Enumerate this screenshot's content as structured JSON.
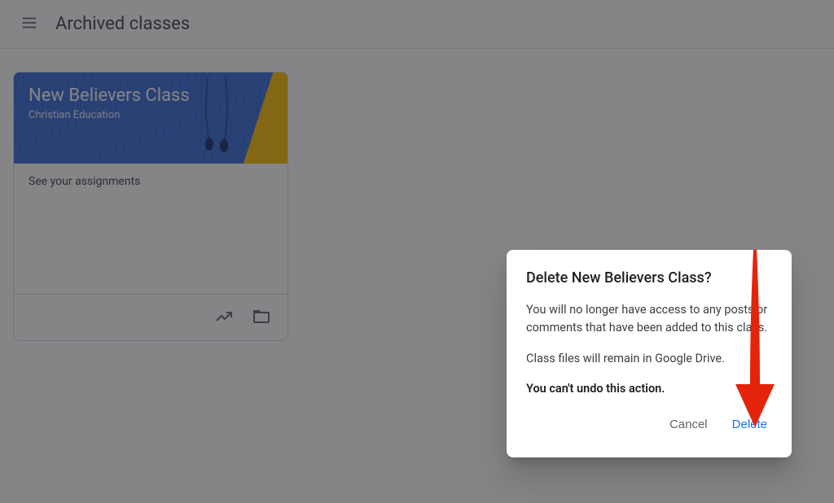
{
  "header": {
    "page_title": "Archived classes"
  },
  "class_card": {
    "title": "New Believers Class",
    "subtitle": "Christian Education",
    "body_text": "See your assignments"
  },
  "dialog": {
    "title": "Delete New Believers Class?",
    "paragraph1": "You will no longer have access to any posts or comments that have been added to this class.",
    "paragraph2": "Class files will remain in Google Drive.",
    "paragraph3": "You can't undo this action.",
    "cancel_label": "Cancel",
    "confirm_label": "Delete"
  },
  "annotation": {
    "arrow_color": "#e4240a"
  }
}
